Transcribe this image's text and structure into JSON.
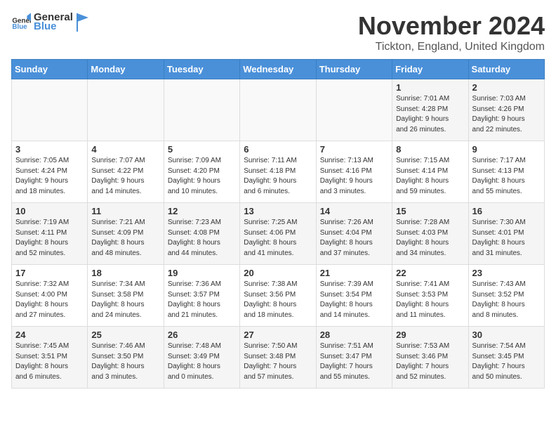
{
  "header": {
    "logo_general": "General",
    "logo_blue": "Blue",
    "month_title": "November 2024",
    "location": "Tickton, England, United Kingdom"
  },
  "weekdays": [
    "Sunday",
    "Monday",
    "Tuesday",
    "Wednesday",
    "Thursday",
    "Friday",
    "Saturday"
  ],
  "weeks": [
    [
      {
        "day": "",
        "info": ""
      },
      {
        "day": "",
        "info": ""
      },
      {
        "day": "",
        "info": ""
      },
      {
        "day": "",
        "info": ""
      },
      {
        "day": "",
        "info": ""
      },
      {
        "day": "1",
        "info": "Sunrise: 7:01 AM\nSunset: 4:28 PM\nDaylight: 9 hours\nand 26 minutes."
      },
      {
        "day": "2",
        "info": "Sunrise: 7:03 AM\nSunset: 4:26 PM\nDaylight: 9 hours\nand 22 minutes."
      }
    ],
    [
      {
        "day": "3",
        "info": "Sunrise: 7:05 AM\nSunset: 4:24 PM\nDaylight: 9 hours\nand 18 minutes."
      },
      {
        "day": "4",
        "info": "Sunrise: 7:07 AM\nSunset: 4:22 PM\nDaylight: 9 hours\nand 14 minutes."
      },
      {
        "day": "5",
        "info": "Sunrise: 7:09 AM\nSunset: 4:20 PM\nDaylight: 9 hours\nand 10 minutes."
      },
      {
        "day": "6",
        "info": "Sunrise: 7:11 AM\nSunset: 4:18 PM\nDaylight: 9 hours\nand 6 minutes."
      },
      {
        "day": "7",
        "info": "Sunrise: 7:13 AM\nSunset: 4:16 PM\nDaylight: 9 hours\nand 3 minutes."
      },
      {
        "day": "8",
        "info": "Sunrise: 7:15 AM\nSunset: 4:14 PM\nDaylight: 8 hours\nand 59 minutes."
      },
      {
        "day": "9",
        "info": "Sunrise: 7:17 AM\nSunset: 4:13 PM\nDaylight: 8 hours\nand 55 minutes."
      }
    ],
    [
      {
        "day": "10",
        "info": "Sunrise: 7:19 AM\nSunset: 4:11 PM\nDaylight: 8 hours\nand 52 minutes."
      },
      {
        "day": "11",
        "info": "Sunrise: 7:21 AM\nSunset: 4:09 PM\nDaylight: 8 hours\nand 48 minutes."
      },
      {
        "day": "12",
        "info": "Sunrise: 7:23 AM\nSunset: 4:08 PM\nDaylight: 8 hours\nand 44 minutes."
      },
      {
        "day": "13",
        "info": "Sunrise: 7:25 AM\nSunset: 4:06 PM\nDaylight: 8 hours\nand 41 minutes."
      },
      {
        "day": "14",
        "info": "Sunrise: 7:26 AM\nSunset: 4:04 PM\nDaylight: 8 hours\nand 37 minutes."
      },
      {
        "day": "15",
        "info": "Sunrise: 7:28 AM\nSunset: 4:03 PM\nDaylight: 8 hours\nand 34 minutes."
      },
      {
        "day": "16",
        "info": "Sunrise: 7:30 AM\nSunset: 4:01 PM\nDaylight: 8 hours\nand 31 minutes."
      }
    ],
    [
      {
        "day": "17",
        "info": "Sunrise: 7:32 AM\nSunset: 4:00 PM\nDaylight: 8 hours\nand 27 minutes."
      },
      {
        "day": "18",
        "info": "Sunrise: 7:34 AM\nSunset: 3:58 PM\nDaylight: 8 hours\nand 24 minutes."
      },
      {
        "day": "19",
        "info": "Sunrise: 7:36 AM\nSunset: 3:57 PM\nDaylight: 8 hours\nand 21 minutes."
      },
      {
        "day": "20",
        "info": "Sunrise: 7:38 AM\nSunset: 3:56 PM\nDaylight: 8 hours\nand 18 minutes."
      },
      {
        "day": "21",
        "info": "Sunrise: 7:39 AM\nSunset: 3:54 PM\nDaylight: 8 hours\nand 14 minutes."
      },
      {
        "day": "22",
        "info": "Sunrise: 7:41 AM\nSunset: 3:53 PM\nDaylight: 8 hours\nand 11 minutes."
      },
      {
        "day": "23",
        "info": "Sunrise: 7:43 AM\nSunset: 3:52 PM\nDaylight: 8 hours\nand 8 minutes."
      }
    ],
    [
      {
        "day": "24",
        "info": "Sunrise: 7:45 AM\nSunset: 3:51 PM\nDaylight: 8 hours\nand 6 minutes."
      },
      {
        "day": "25",
        "info": "Sunrise: 7:46 AM\nSunset: 3:50 PM\nDaylight: 8 hours\nand 3 minutes."
      },
      {
        "day": "26",
        "info": "Sunrise: 7:48 AM\nSunset: 3:49 PM\nDaylight: 8 hours\nand 0 minutes."
      },
      {
        "day": "27",
        "info": "Sunrise: 7:50 AM\nSunset: 3:48 PM\nDaylight: 7 hours\nand 57 minutes."
      },
      {
        "day": "28",
        "info": "Sunrise: 7:51 AM\nSunset: 3:47 PM\nDaylight: 7 hours\nand 55 minutes."
      },
      {
        "day": "29",
        "info": "Sunrise: 7:53 AM\nSunset: 3:46 PM\nDaylight: 7 hours\nand 52 minutes."
      },
      {
        "day": "30",
        "info": "Sunrise: 7:54 AM\nSunset: 3:45 PM\nDaylight: 7 hours\nand 50 minutes."
      }
    ]
  ]
}
